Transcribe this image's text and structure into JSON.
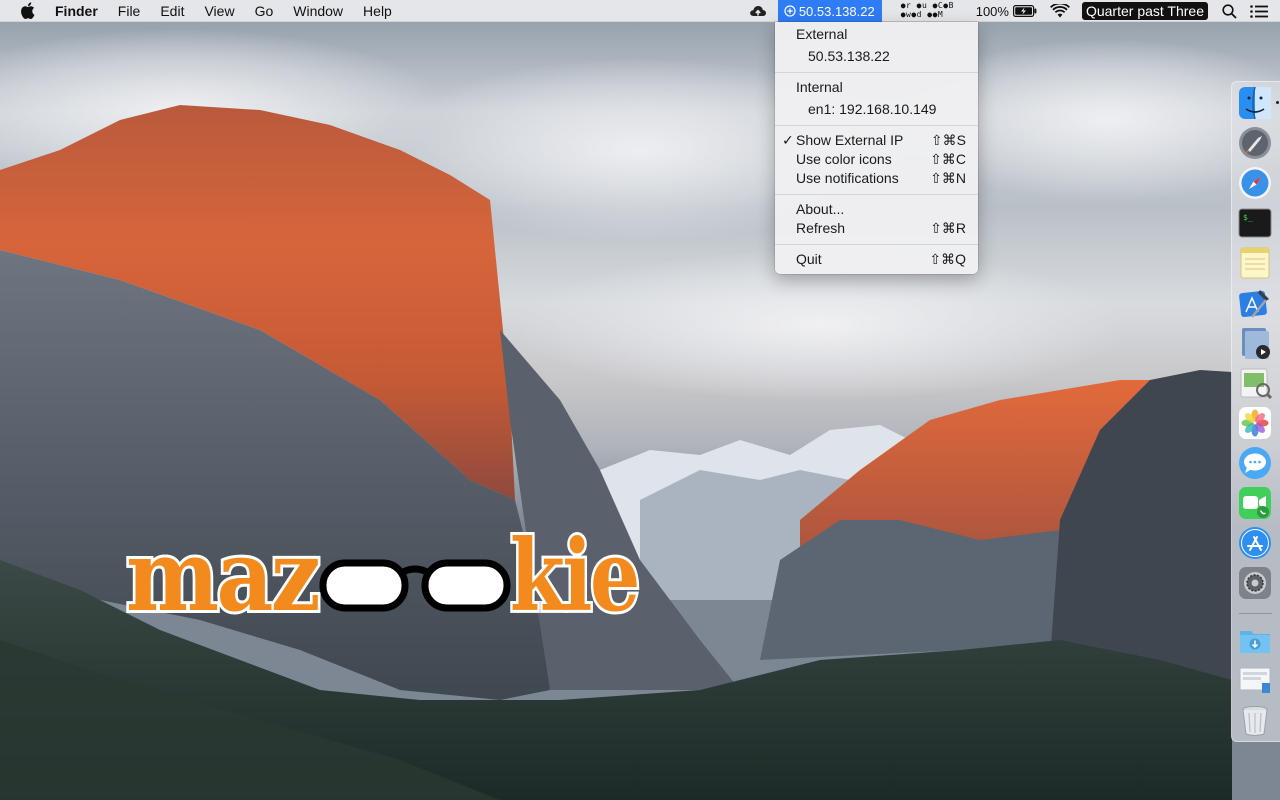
{
  "menubar": {
    "app_name": "Finder",
    "menus": [
      "File",
      "Edit",
      "View",
      "Go",
      "Window",
      "Help"
    ],
    "ip_status": "50.53.138.22",
    "dots_rows": [
      "●r ●u ●C●B",
      "●w●d ●●M"
    ],
    "battery_percent": "100%",
    "clock_text": "Quarter past Three",
    "icons": [
      "apple-icon",
      "cloud-upload-icon",
      "globe-icon",
      "battery-charging-icon",
      "wifi-icon",
      "search-icon",
      "notification-list-icon"
    ],
    "accent_color": "#2e7cf6"
  },
  "ip_menu": {
    "external_header": "External",
    "external_ip": "50.53.138.22",
    "internal_header": "Internal",
    "internal_ip": "en1: 192.168.10.149",
    "options": [
      {
        "label": "Show External IP",
        "shortcut": "⇧⌘S",
        "checked": true,
        "check_mark": "✓"
      },
      {
        "label": "Use color icons",
        "shortcut": "⇧⌘C",
        "checked": false
      },
      {
        "label": "Use notifications",
        "shortcut": "⇧⌘N",
        "checked": false
      }
    ],
    "about_label": "About...",
    "refresh_label": "Refresh",
    "refresh_shortcut": "⇧⌘R",
    "quit_label": "Quit",
    "quit_shortcut": "⇧⌘Q"
  },
  "wallpaper": {
    "logo_text": "mazookie",
    "logo_color": "#f28a1e"
  },
  "dock": {
    "apps": [
      "finder-icon",
      "launchpad-icon",
      "safari-icon",
      "terminal-icon",
      "notes-icon",
      "xcode-icon",
      "quicktime-icon",
      "preview-icon",
      "photos-icon",
      "messages-icon",
      "facetime-icon",
      "app-store-icon",
      "system-preferences-icon",
      "downloads-folder-icon",
      "screenshot-icon",
      "trash-icon"
    ]
  }
}
